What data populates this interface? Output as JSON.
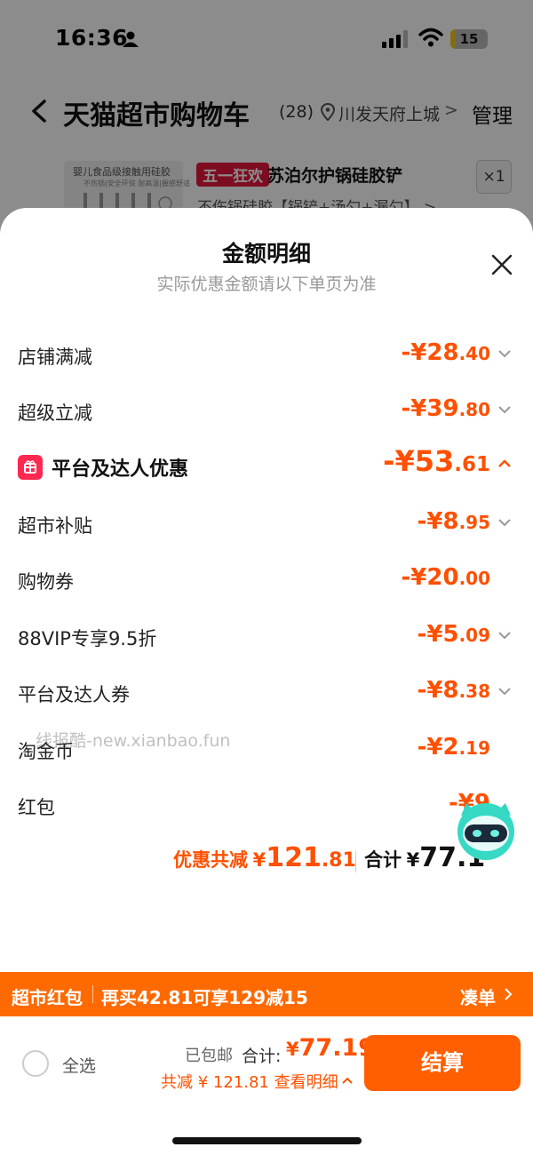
{
  "status_bar": {
    "time": "16:36",
    "battery_level": "15",
    "battery_fraction": 0.15
  },
  "nav": {
    "title": "天猫超市购物车",
    "count": "(28)",
    "location": "川发天府上城",
    "manage": "管理"
  },
  "product": {
    "thumb_title": "婴儿食品级接触用硅胶",
    "thumb_sub": "不伤锅|安全环保 耐高温|握感舒适",
    "tag": "五一狂欢",
    "name": "苏泊尔护锅硅胶铲",
    "desc": "不伤锅硅胶【锅铲+汤勺+漏勺】 >",
    "qty": "×1"
  },
  "sheet": {
    "title": "金额明细",
    "subtitle": "实际优惠金额请以下单页为准",
    "rows": [
      {
        "label": "店铺满减",
        "sign": "-¥",
        "int": "28",
        "dec": ".40"
      },
      {
        "label": "超级立减",
        "sign": "-¥",
        "int": "39",
        "dec": ".80"
      },
      {
        "label": "平台及达人优惠",
        "sign": "-¥",
        "int": "53",
        "dec": ".61"
      },
      {
        "label": "超市补贴",
        "sign": "-¥",
        "int": "8",
        "dec": ".95"
      },
      {
        "label": "购物券",
        "sign": "-¥",
        "int": "20",
        "dec": ".00"
      },
      {
        "label": "88VIP专享9.5折",
        "sign": "-¥",
        "int": "5",
        "dec": ".09"
      },
      {
        "label": "平台及达人券",
        "sign": "-¥",
        "int": "8",
        "dec": ".38"
      },
      {
        "label": "淘金币",
        "sign": "-¥",
        "int": "2",
        "dec": ".19"
      },
      {
        "label": "红包",
        "sign": "-¥",
        "int": "9",
        "dec": ""
      }
    ],
    "watermark": "线报酷-new.xianbao.fun",
    "total_discount_label": "优惠共减",
    "total_discount_cur": "¥",
    "total_discount_int": "121",
    "total_discount_dec": ".81",
    "total_label": "合计",
    "total_cur": "¥",
    "total_int": "77.1"
  },
  "promo": {
    "tag": "超市红包",
    "text": "再买42.81可享129减15",
    "link": "凑单"
  },
  "bottom": {
    "select_all": "全选",
    "shipping": "已包邮",
    "sum_label": "合计:",
    "sum_cur": "¥",
    "sum_value": "77.19",
    "detail": "共减 ¥ 121.81  查看明细",
    "checkout": "结算"
  },
  "colors": {
    "accent": "#ff5000",
    "promo_bg": "#ff6a00",
    "tag_red": "#e6173d"
  }
}
